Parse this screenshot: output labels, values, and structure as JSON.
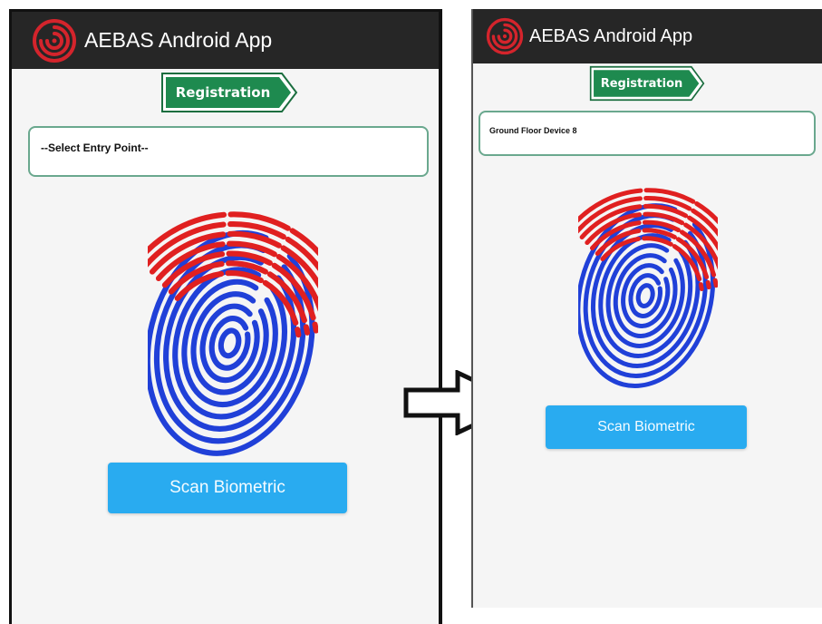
{
  "screens": [
    {
      "app_title": "AEBAS Android App",
      "sign_label": "Registration",
      "entry_point_value": "--Select Entry Point--",
      "scan_button_label": "Scan Biometric"
    },
    {
      "app_title": "AEBAS Android App",
      "sign_label": "Registration",
      "entry_point_value": "Ground Floor Device 8",
      "scan_button_label": "Scan Biometric"
    }
  ],
  "icons": {
    "logo": "fingerprint-logo-icon",
    "fingerprint": "fingerprint-icon",
    "transition_arrow": "right-arrow-icon"
  },
  "colors": {
    "appbar": "#262626",
    "logo_red": "#d4242c",
    "sign_green": "#1e8a4f",
    "fingerprint_red": "#e02020",
    "fingerprint_blue": "#2040d8",
    "button_blue": "#29abf0",
    "field_border": "#6aa88e"
  }
}
